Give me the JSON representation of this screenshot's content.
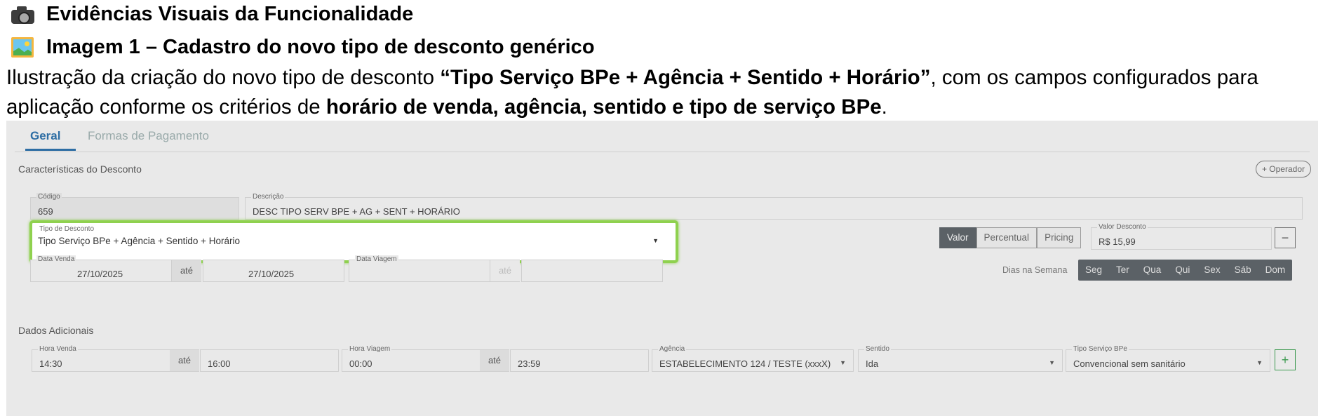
{
  "doc": {
    "heading1": "Evidências Visuais da Funcionalidade",
    "heading2": "Imagem 1 – Cadastro do novo tipo de desconto genérico",
    "para_part1": "Ilustração da criação do novo tipo de desconto ",
    "para_bold1": "“Tipo Serviço BPe + Agência + Sentido + Horário”",
    "para_part2": ", com os campos configurados para aplicação conforme os critérios de ",
    "para_bold2": "horário de venda, agência, sentido e tipo de serviço BPe",
    "para_end": ".",
    "icons": [
      "camera-icon",
      "framed-picture-icon"
    ]
  },
  "tabs": {
    "geral": "Geral",
    "formas": "Formas de Pagamento"
  },
  "section1": {
    "title": "Características do Desconto",
    "operador": "+ Operador",
    "codigo_label": "Código",
    "codigo_value": "659",
    "descricao_label": "Descrição",
    "descricao_value": "DESC TIPO SERV BPE + AG + SENT + HORÁRIO",
    "tipo_label": "Tipo de Desconto",
    "tipo_value": "Tipo Serviço BPe + Agência + Sentido + Horário",
    "mode_valor": "Valor",
    "mode_percentual": "Percentual",
    "mode_pricing": "Pricing",
    "valor_label": "Valor Desconto",
    "valor_value": "R$ 15,99",
    "minus": "−",
    "data_venda_label": "Data Venda",
    "data_venda_from": "27/10/2025",
    "ate": "até",
    "data_venda_to": "27/10/2025",
    "data_viagem_label": "Data Viagem",
    "dias_label": "Dias na Semana",
    "days": [
      "Seg",
      "Ter",
      "Qua",
      "Qui",
      "Sex",
      "Sáb",
      "Dom"
    ],
    "accent_color": "#8fd14f"
  },
  "section2": {
    "title": "Dados Adicionais",
    "hora_venda_label": "Hora Venda",
    "hora_venda_from": "14:30",
    "hora_venda_to": "16:00",
    "hora_viagem_label": "Hora Viagem",
    "hora_viagem_from": "00:00",
    "hora_viagem_to": "23:59",
    "agencia_label": "Agência",
    "agencia_value": "ESTABELECIMENTO 124 / TESTE (xxxX)",
    "sentido_label": "Sentido",
    "sentido_value": "Ida",
    "tipo_servico_label": "Tipo Serviço BPe",
    "tipo_servico_value": "Convencional sem sanitário",
    "plus": "+"
  }
}
